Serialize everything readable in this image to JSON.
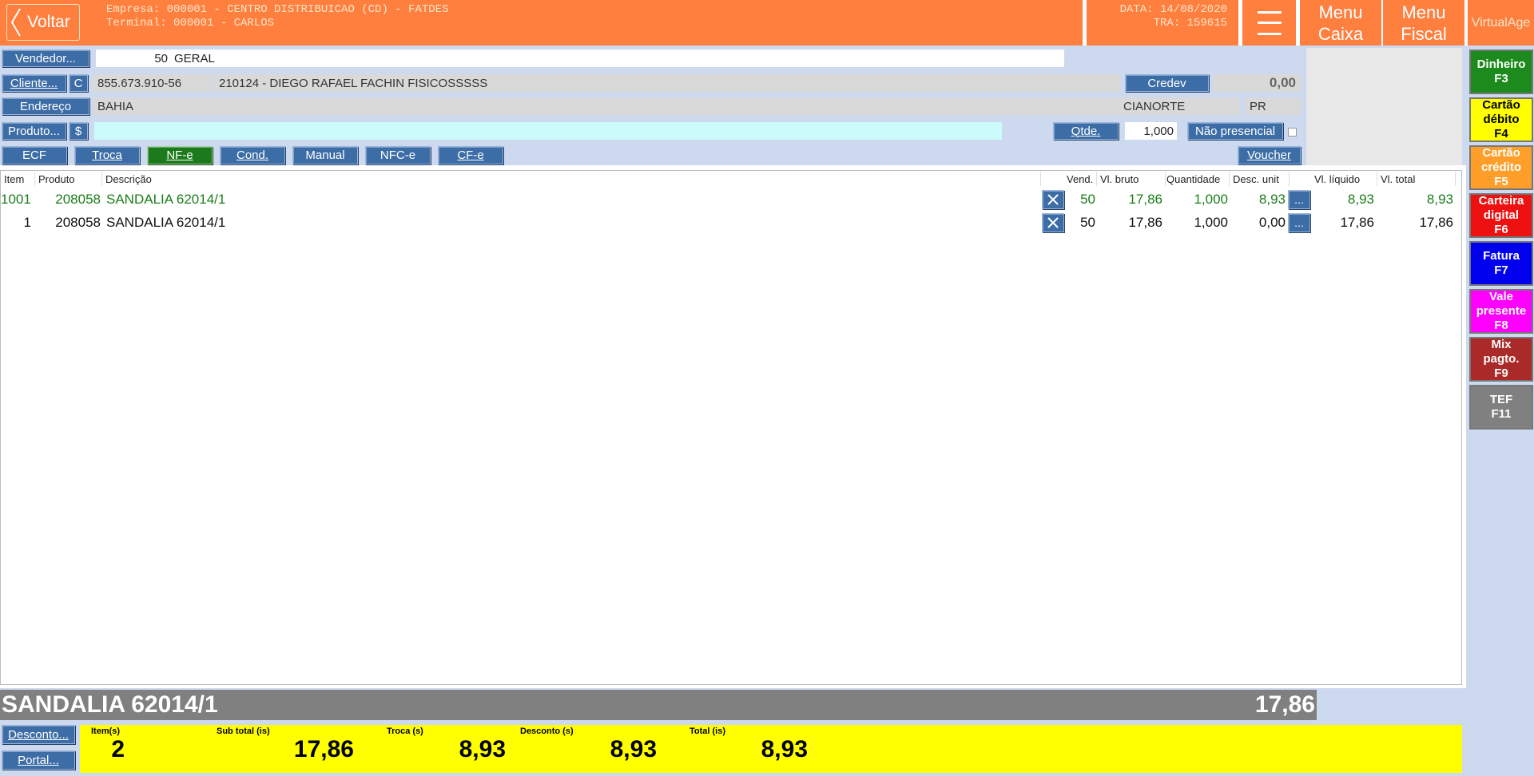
{
  "header": {
    "back_label": "Voltar",
    "company_line": "Empresa: 000001 - CENTRO DISTRIBUICAO (CD) - FATDES",
    "terminal_line": "Terminal: 000001 - CARLOS",
    "date_line": "DATA: 14/08/2020",
    "tra_line": "TRA: 159615",
    "menu_caixa_1": "Menu",
    "menu_caixa_2": "Caixa",
    "menu_fiscal_1": "Menu",
    "menu_fiscal_2": "Fiscal",
    "brand": "VirtualAge"
  },
  "form": {
    "vendedor_label": "Vendedor...",
    "vendedor_code": "50",
    "vendedor_name": "GERAL",
    "cliente_label": "Cliente...",
    "cliente_c": "C",
    "cliente_doc": "855.673.910-56",
    "cliente_name": "210124 - DIEGO RAFAEL FACHIN FISICOSSSSS",
    "credev_label": "Credev",
    "credev_value": "0,00",
    "endereco_label": "Endereço",
    "endereco_value": "BAHIA",
    "cidade": "CIANORTE",
    "uf": "PR",
    "produto_label": "Produto...",
    "produto_dollar": "$",
    "produto_value": "",
    "qtde_label": "Qtde.",
    "qtde_value": "1,000",
    "nao_presencial_label": "Não presencial"
  },
  "modes": {
    "ecf": "ECF",
    "troca": "Troca",
    "nfe": "NF-e",
    "cond": "Cond.",
    "manual": "Manual",
    "nfce": "NFC-e",
    "cfe": "CF-e",
    "voucher": "Voucher"
  },
  "table": {
    "headers": {
      "item": "Item",
      "produto": "Produto",
      "descricao": "Descrição",
      "vend": "Vend.",
      "vl_bruto": "Vl. bruto",
      "quantidade": "Quantidade",
      "desc_unit": "Desc. unit",
      "vl_liquido": "Vl. líquido",
      "vl_total": "Vl. total"
    },
    "rows": [
      {
        "item": "1001",
        "produto": "208058",
        "descricao": "SANDALIA 62014/1",
        "vend": "50",
        "vl_bruto": "17,86",
        "quantidade": "1,000",
        "desc_unit": "8,93",
        "more": "...",
        "vl_liquido": "8,93",
        "vl_total": "8,93"
      },
      {
        "item": "1",
        "produto": "208058",
        "descricao": "SANDALIA 62014/1",
        "vend": "50",
        "vl_bruto": "17,86",
        "quantidade": "1,000",
        "desc_unit": "0,00",
        "more": "...",
        "vl_liquido": "17,86",
        "vl_total": "17,86"
      }
    ]
  },
  "footer": {
    "current_desc": "SANDALIA 62014/1",
    "current_value": "17,86",
    "desconto_label": "Desconto...",
    "portal_label": "Portal...",
    "itens_label": "Item(s)",
    "itens_value": "2",
    "subtotal_label": "Sub total (is)",
    "subtotal_value": "17,86",
    "troca_label": "Troca (s)",
    "troca_value": "8,93",
    "desconto_tot_label": "Desconto (s)",
    "desconto_tot_value": "8,93",
    "total_label": "Total (is)",
    "total_value": "8,93"
  },
  "payments": [
    {
      "line1": "Dinheiro",
      "line2": "",
      "line3": "F3",
      "bg": "#1c8a1c",
      "fg": "#ffffff"
    },
    {
      "line1": "Cartão",
      "line2": "débito",
      "line3": "F4",
      "bg": "#ffff00",
      "fg": "#000000"
    },
    {
      "line1": "Cartão",
      "line2": "crédito",
      "line3": "F5",
      "bg": "#ff9f2a",
      "fg": "#ffffff"
    },
    {
      "line1": "Carteira",
      "line2": "digital",
      "line3": "F6",
      "bg": "#ee1111",
      "fg": "#ffffff"
    },
    {
      "line1": "Fatura",
      "line2": "",
      "line3": "F7",
      "bg": "#0000ee",
      "fg": "#ffffff"
    },
    {
      "line1": "Vale",
      "line2": "presente",
      "line3": "F8",
      "bg": "#ff00ff",
      "fg": "#ffffff"
    },
    {
      "line1": "Mix",
      "line2": "pagto.",
      "line3": "F9",
      "bg": "#aa2a2a",
      "fg": "#ffffff"
    },
    {
      "line1": "TEF",
      "line2": "",
      "line3": "F11",
      "bg": "#808080",
      "fg": "#ffffff"
    }
  ]
}
